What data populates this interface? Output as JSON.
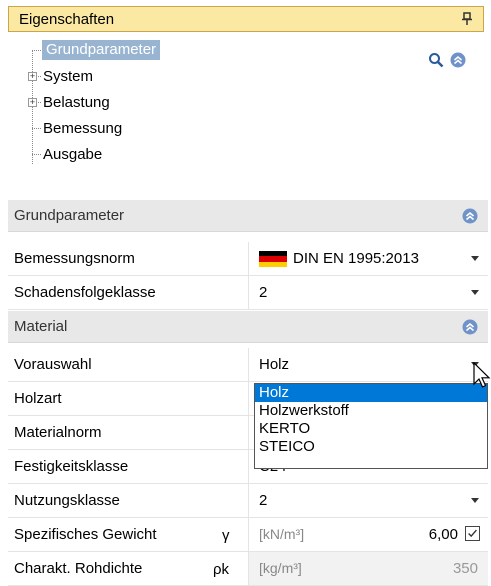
{
  "panel": {
    "title": "Eigenschaften"
  },
  "tree": {
    "items": [
      {
        "label": "Grundparameter",
        "expandable": false,
        "selected": true
      },
      {
        "label": "System",
        "expandable": true,
        "selected": false
      },
      {
        "label": "Belastung",
        "expandable": true,
        "selected": false
      },
      {
        "label": "Bemessung",
        "expandable": false,
        "selected": false
      },
      {
        "label": "Ausgabe",
        "expandable": false,
        "selected": false
      }
    ]
  },
  "sections": {
    "grundparameter": {
      "title": "Grundparameter"
    },
    "material": {
      "title": "Material"
    }
  },
  "rows": {
    "bemessungsnorm": {
      "label": "Bemessungsnorm",
      "value": "DIN EN 1995:2013"
    },
    "schadensfolgeklasse": {
      "label": "Schadensfolgeklasse",
      "value": "2"
    },
    "vorauswahl": {
      "label": "Vorauswahl",
      "value": "Holz"
    },
    "holzart": {
      "label": "Holzart",
      "value": ""
    },
    "materialnorm": {
      "label": "Materialnorm",
      "value": ""
    },
    "festigkeitsklasse": {
      "label": "Festigkeitsklasse",
      "value": "C24"
    },
    "nutzungsklasse": {
      "label": "Nutzungsklasse",
      "value": "2"
    },
    "spezifisches_gewicht": {
      "label": "Spezifisches Gewicht",
      "symbol": "γ",
      "unit": "[kN/m³]",
      "value": "6,00",
      "checked": true
    },
    "rohdichte": {
      "label": "Charakt. Rohdichte",
      "symbol": "ρk",
      "unit": "[kg/m³]",
      "value": "350"
    }
  },
  "dropdown": {
    "options": [
      "Holz",
      "Holzwerkstoff",
      "KERTO",
      "STEICO"
    ],
    "selected": "Holz"
  },
  "colors": {
    "title_bg": "#fbe9a3",
    "tree_selection": "#99b4d1",
    "section_bg": "#e8e8e8",
    "dropdown_selection": "#0078d7"
  },
  "icons": [
    "pin-icon",
    "search-icon",
    "collapse-icon",
    "expand-plus-icon",
    "dropdown-arrow-icon",
    "german-flag-icon",
    "checkbox-icon",
    "mouse-cursor-icon"
  ]
}
